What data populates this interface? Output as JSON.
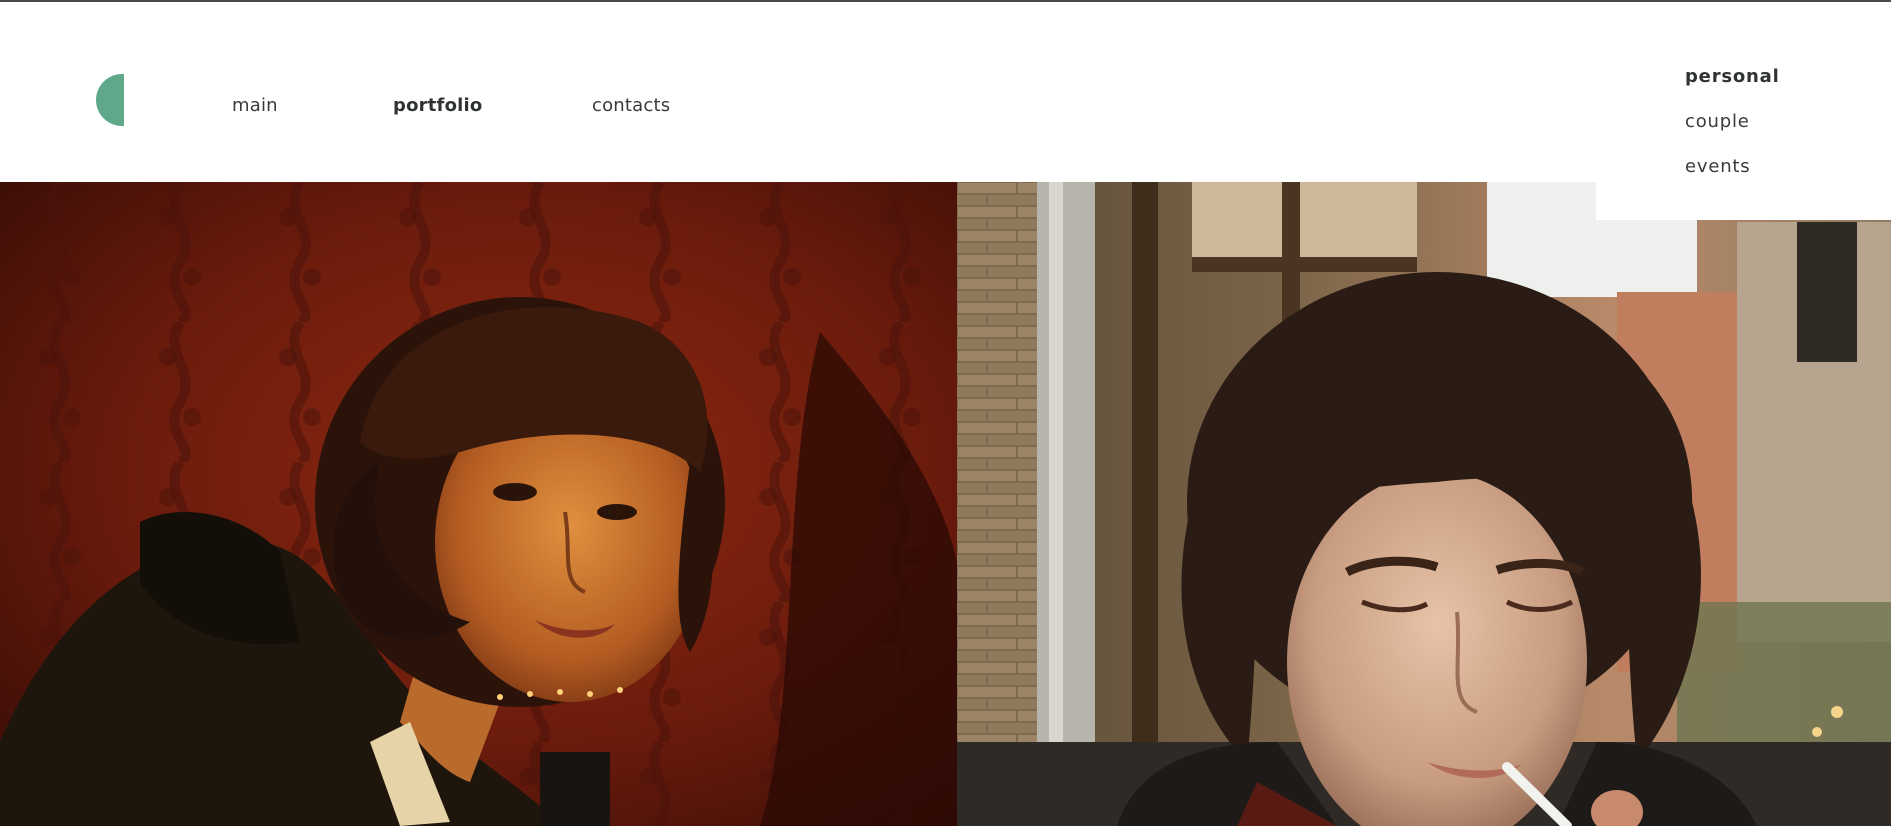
{
  "nav": {
    "items": [
      {
        "label": "main",
        "active": false
      },
      {
        "label": "portfolio",
        "active": true
      },
      {
        "label": "contacts",
        "active": false
      }
    ]
  },
  "portfolio_submenu": {
    "items": [
      {
        "label": "personal",
        "active": true
      },
      {
        "label": "couple",
        "active": false
      },
      {
        "label": "events",
        "active": false
      }
    ]
  },
  "colors": {
    "accent": "#5fa98a",
    "text": "#3a3a3a",
    "background": "#ffffff"
  },
  "icons": {
    "logo": "half-circle-logo-icon"
  }
}
